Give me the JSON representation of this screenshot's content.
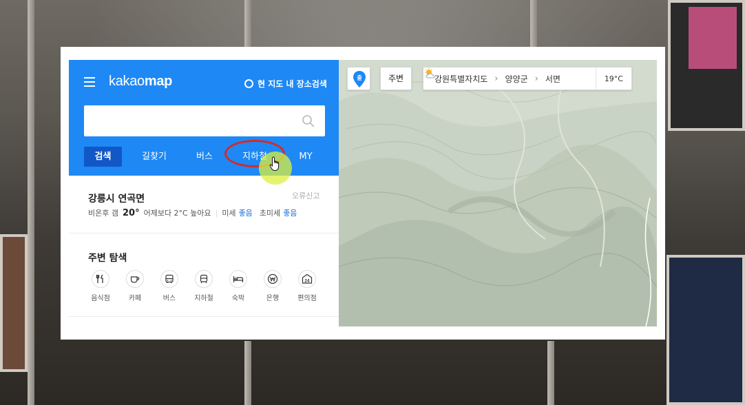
{
  "app": {
    "logo_light": "kakao",
    "logo_bold": "map",
    "area_search_label": "현 지도 내 장소검색",
    "search_placeholder": ""
  },
  "tabs": [
    {
      "label": "검색",
      "active": true
    },
    {
      "label": "길찾기",
      "active": false
    },
    {
      "label": "버스",
      "active": false
    },
    {
      "label": "지하철",
      "active": false
    },
    {
      "label": "MY",
      "active": false
    }
  ],
  "weather": {
    "region": "강릉시 연곡면",
    "report_label": "오류신고",
    "condition": "비온후 갬",
    "temperature": "20°",
    "compare": "어제보다 2°C 높아요",
    "fine_dust_label": "미세",
    "fine_dust_value": "좋음",
    "ultrafine_dust_label": "초미세",
    "ultrafine_dust_value": "좋음"
  },
  "nearby": {
    "title": "주변 탐색",
    "categories": [
      {
        "label": "음식점",
        "icon": "restaurant-icon"
      },
      {
        "label": "카페",
        "icon": "cafe-icon"
      },
      {
        "label": "버스",
        "icon": "bus-icon"
      },
      {
        "label": "지하철",
        "icon": "subway-icon"
      },
      {
        "label": "숙박",
        "icon": "lodging-icon"
      },
      {
        "label": "은행",
        "icon": "bank-icon"
      },
      {
        "label": "편의점",
        "icon": "convenience-store-icon"
      }
    ]
  },
  "map": {
    "pin_label": "출",
    "nearby_button": "주변",
    "breadcrumb": [
      "강원특별자치도",
      "양양군",
      "서면"
    ],
    "weather_temp": "19°C"
  },
  "colors": {
    "brand_blue": "#1e88f5",
    "active_tab": "#1257c6",
    "good_text": "#1e6fd9",
    "map_base": "#c7d1c3",
    "highlight_ring": "#d42a2a"
  }
}
